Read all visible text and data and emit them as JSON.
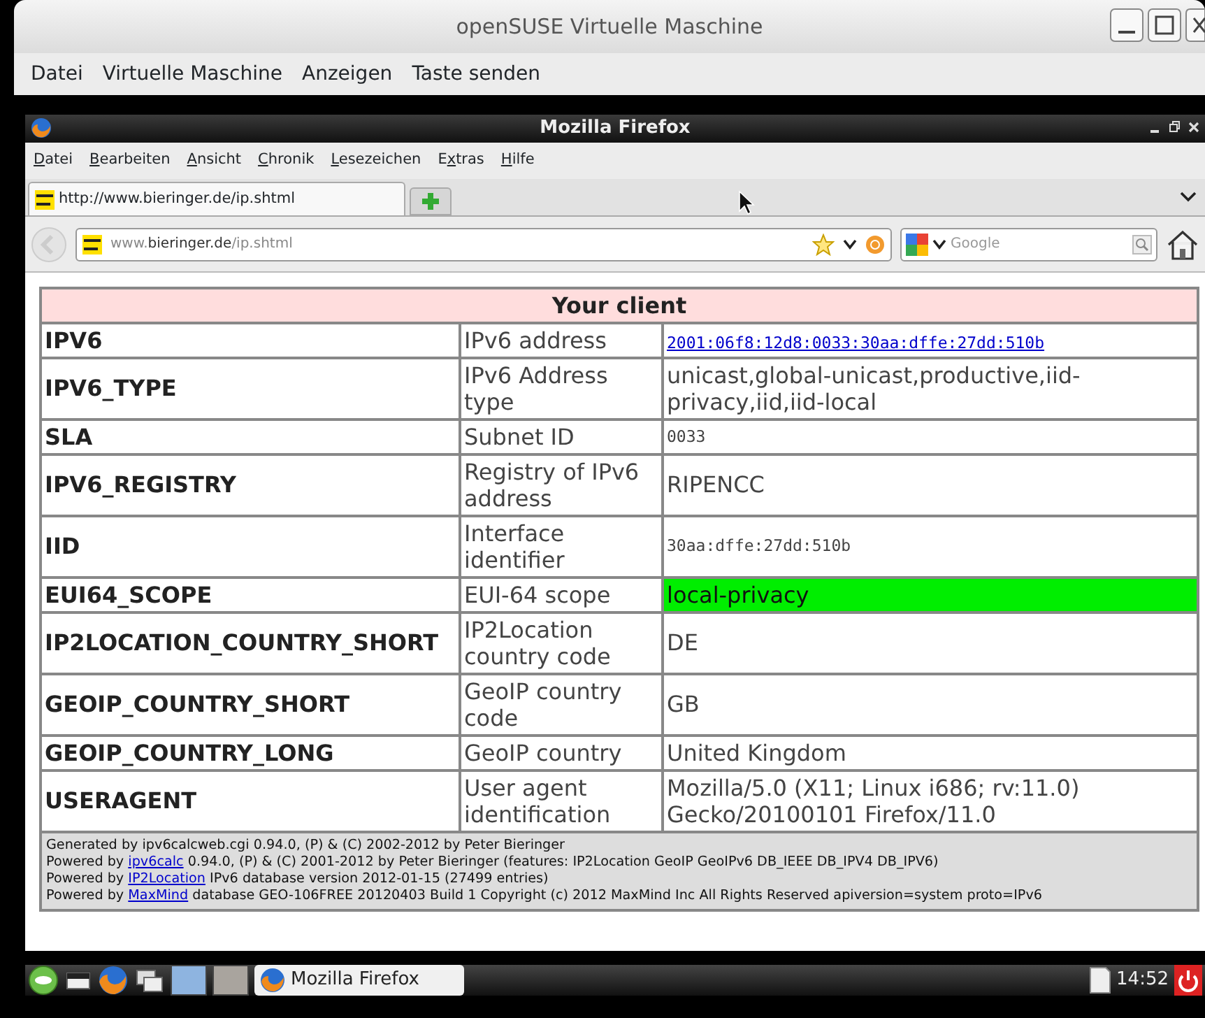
{
  "window": {
    "title": "openSUSE Virtuelle Maschine"
  },
  "menu": [
    "Datei",
    "Virtuelle Maschine",
    "Anzeigen",
    "Taste senden"
  ],
  "browser": {
    "title": "Mozilla Firefox",
    "menu": [
      {
        "key": "D",
        "post": "atei"
      },
      {
        "key": "B",
        "post": "earbeiten"
      },
      {
        "key": "A",
        "post": "nsicht"
      },
      {
        "key": "C",
        "post": "hronik"
      },
      {
        "key": "L",
        "post": "esezeichen"
      },
      {
        "pre": "E",
        "key": "x",
        "post": "tras"
      },
      {
        "key": "H",
        "post": "ilfe"
      }
    ],
    "tabs": [
      {
        "label": "http://www.bieringer.de/ip.shtml",
        "selected": true
      }
    ],
    "address": {
      "prefix": "www.",
      "domain": "bieringer.de",
      "path": "/ip.shtml"
    },
    "search": {
      "placeholder": "Google"
    }
  },
  "table": {
    "heading": "Your client",
    "rows": [
      {
        "key": "IPV6",
        "description": "IPv6 address",
        "value": "2001:06f8:12d8:0033:30aa:dffe:27dd:510b",
        "kind": "link"
      },
      {
        "key": "IPV6_TYPE",
        "description": "IPv6 Address type",
        "value": "unicast,global-unicast,productive,iid-privacy,iid,iid-local",
        "kind": "text"
      },
      {
        "key": "SLA",
        "description": "Subnet ID",
        "value": "0033",
        "kind": "mono"
      },
      {
        "key": "IPV6_REGISTRY",
        "description": "Registry of IPv6 address",
        "value": "RIPENCC",
        "kind": "text"
      },
      {
        "key": "IID",
        "description": "Interface identifier",
        "value": "30aa:dffe:27dd:510b",
        "kind": "mono"
      },
      {
        "key": "EUI64_SCOPE",
        "description": "EUI-64 scope",
        "value": "local-privacy",
        "kind": "highlight"
      },
      {
        "key": "IP2LOCATION_COUNTRY_SHORT",
        "description": "IP2Location country code",
        "value": "DE",
        "kind": "text"
      },
      {
        "key": "GEOIP_COUNTRY_SHORT",
        "description": "GeoIP country code",
        "value": "GB",
        "kind": "text"
      },
      {
        "key": "GEOIP_COUNTRY_LONG",
        "description": "GeoIP country",
        "value": "United Kingdom",
        "kind": "text"
      },
      {
        "key": "USERAGENT",
        "description": "User agent identification",
        "value": "Mozilla/5.0 (X11; Linux i686; rv:11.0) Gecko/20100101 Firefox/11.0",
        "kind": "text"
      }
    ],
    "footer": [
      {
        "before": "Generated by ipv6calcweb.cgi 0.94.0, (P) & (C) 2002-2012 by Peter Bieringer"
      },
      {
        "before": "Powered by ",
        "link": "ipv6calc",
        "after": " 0.94.0, (P) & (C) 2001-2012 by Peter Bieringer (features: IP2Location GeoIP GeoIPv6 DB_IEEE DB_IPV4 DB_IPV6)"
      },
      {
        "before": "Powered by ",
        "link": "IP2Location",
        "after": " IPv6 database version 2012-01-15 (27499 entries)"
      },
      {
        "before": "Powered by ",
        "link": "MaxMind",
        "after": " database GEO-106FREE 20120403 Build 1 Copyright (c) 2012 MaxMind Inc All Rights Reserved apiversion=system proto=IPv6"
      }
    ]
  },
  "taskbar": {
    "task": "Mozilla Firefox",
    "clock": "14:52"
  }
}
